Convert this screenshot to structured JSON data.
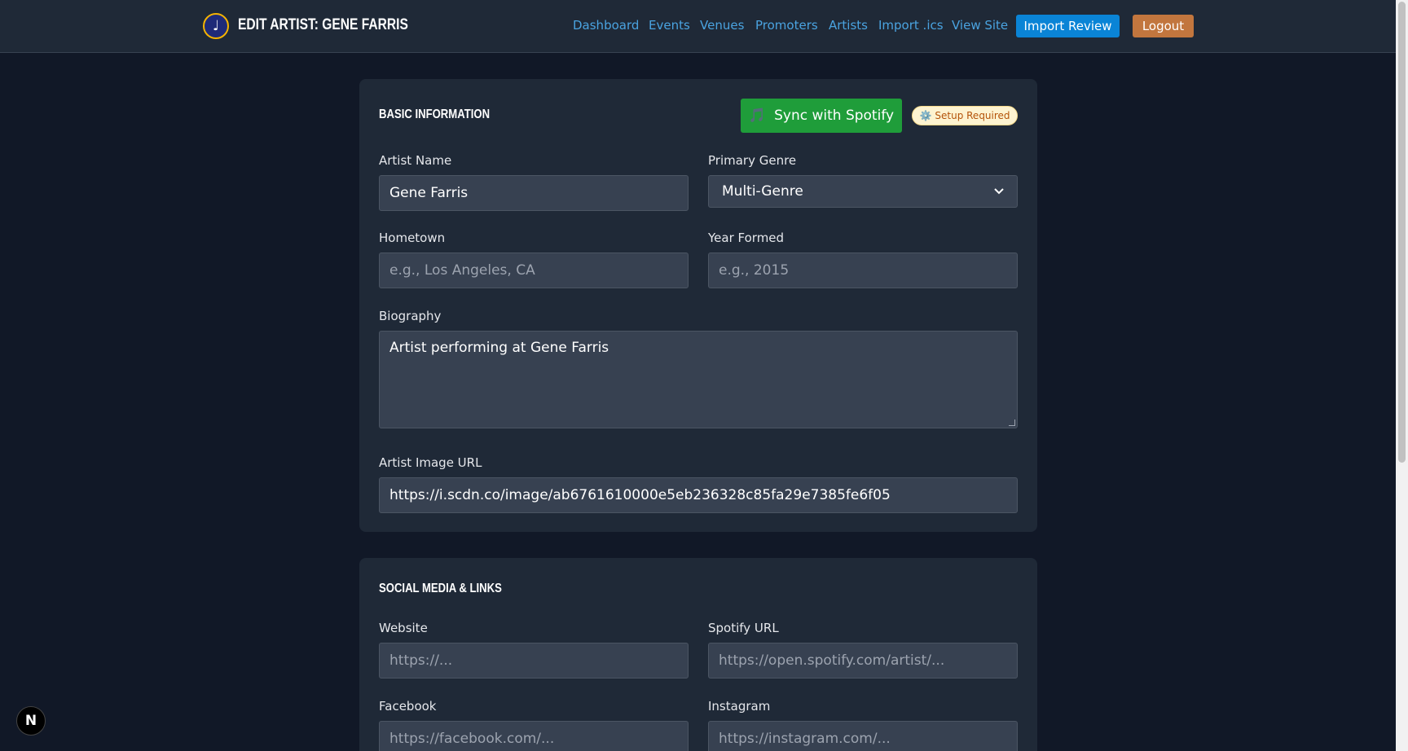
{
  "header": {
    "logo_icon": "♩",
    "title": "EDIT ARTIST: GENE FARRIS",
    "nav": [
      "Dashboard",
      "Events",
      "Venues",
      "Promoters",
      "Artists",
      "Import .ics",
      "View Site"
    ],
    "import_review_label": "Import Review",
    "logout_label": "Logout"
  },
  "basic": {
    "title": "BASIC INFORMATION",
    "spotify_button_icon": "🎵",
    "spotify_button_label": "Sync with Spotify",
    "setup_badge_icon": "⚙️",
    "setup_badge_label": "Setup Required",
    "artist_name_label": "Artist Name",
    "artist_name_value": "Gene Farris",
    "genre_label": "Primary Genre",
    "genre_value": "Multi-Genre",
    "hometown_label": "Hometown",
    "hometown_placeholder": "e.g., Los Angeles, CA",
    "year_label": "Year Formed",
    "year_placeholder": "e.g., 2015",
    "bio_label": "Biography",
    "bio_value": "Artist performing at Gene Farris",
    "image_label": "Artist Image URL",
    "image_value": "https://i.scdn.co/image/ab6761610000e5eb236328c85fa29e7385fe6f05"
  },
  "social": {
    "title": "SOCIAL MEDIA & LINKS",
    "website_label": "Website",
    "website_placeholder": "https://...",
    "spotify_label": "Spotify URL",
    "spotify_placeholder": "https://open.spotify.com/artist/...",
    "facebook_label": "Facebook",
    "facebook_placeholder": "https://facebook.com/...",
    "instagram_label": "Instagram",
    "instagram_placeholder": "https://instagram.com/..."
  },
  "dev_badge": "N",
  "colors": {
    "background": "#111827",
    "card": "#1f2937",
    "link": "#4aa3e0",
    "import_button": "#0a84d6",
    "logout_button": "#c2763e",
    "spotify_button": "#1f9d3a"
  }
}
